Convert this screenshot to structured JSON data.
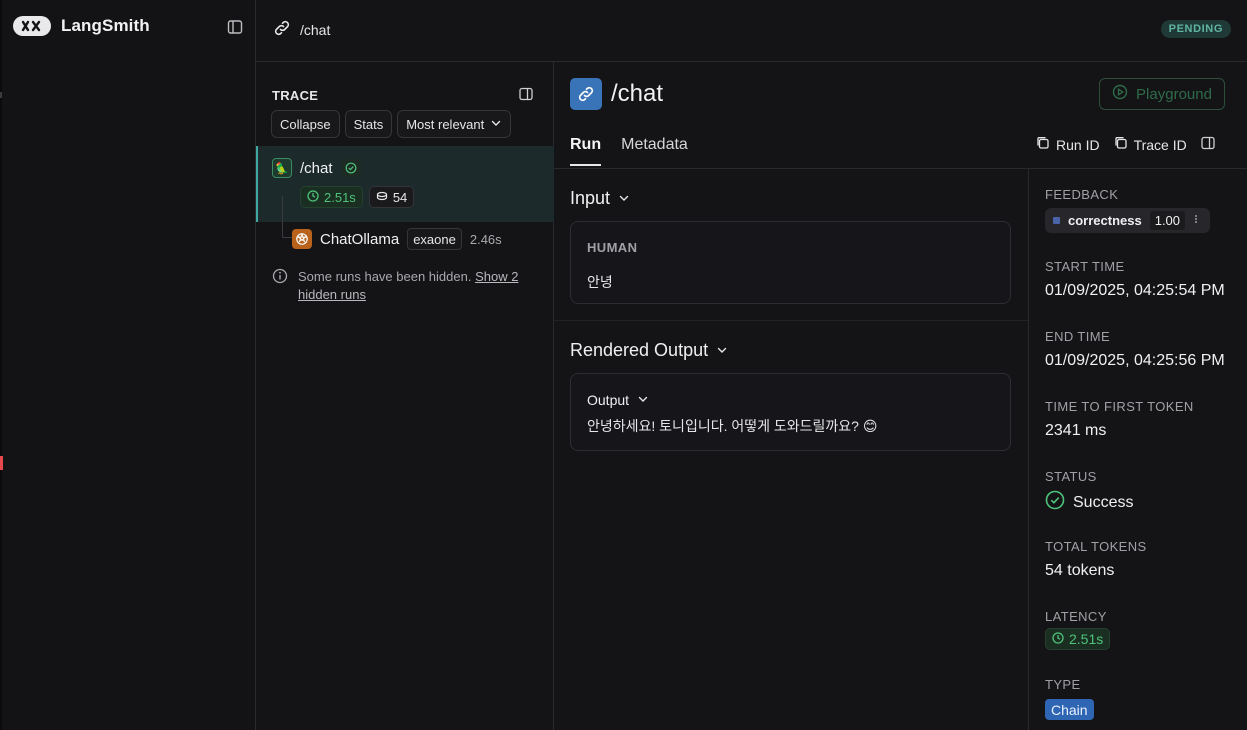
{
  "app": {
    "brand": "LangSmith"
  },
  "header": {
    "breadcrumb": "/chat",
    "status_badge": "PENDING"
  },
  "trace": {
    "title": "TRACE",
    "buttons": {
      "collapse": "Collapse",
      "stats": "Stats",
      "sort": "Most relevant"
    },
    "root": {
      "name": "/chat",
      "latency": "2.51s",
      "tokens": "54"
    },
    "child": {
      "name": "ChatOllama",
      "tag": "exaone",
      "latency": "2.46s"
    },
    "hidden_note": {
      "text": "Some runs have been hidden. ",
      "link": "Show 2 hidden runs"
    }
  },
  "main": {
    "title": "/chat",
    "tabs": [
      "Run",
      "Metadata"
    ],
    "playground_label": "Playground",
    "run_id_label": "Run ID",
    "trace_id_label": "Trace ID",
    "input": {
      "heading": "Input",
      "role": "HUMAN",
      "message": "안녕"
    },
    "output": {
      "heading": "Rendered Output",
      "label": "Output",
      "message": "안녕하세요! 토니입니다. 어떻게 도와드릴까요? 😊"
    }
  },
  "meta": {
    "feedback_label": "FEEDBACK",
    "feedback_key": "correctness",
    "feedback_score": "1.00",
    "start_label": "START TIME",
    "start_value": "01/09/2025, 04:25:54 PM",
    "end_label": "END TIME",
    "end_value": "01/09/2025, 04:25:56 PM",
    "ttft_label": "TIME TO FIRST TOKEN",
    "ttft_value": "2341 ms",
    "status_label": "STATUS",
    "status_value": "Success",
    "tokens_label": "TOTAL TOKENS",
    "tokens_value": "54 tokens",
    "latency_label": "LATENCY",
    "latency_value": "2.51s",
    "type_label": "TYPE",
    "type_value": "Chain"
  },
  "colors": {
    "accent_teal": "#3fa6a0",
    "success": "#4ec37a",
    "chain_blue": "#2f66b3",
    "link_icon_bg": "#3a74b8",
    "ollama_orange": "#b8621b"
  }
}
